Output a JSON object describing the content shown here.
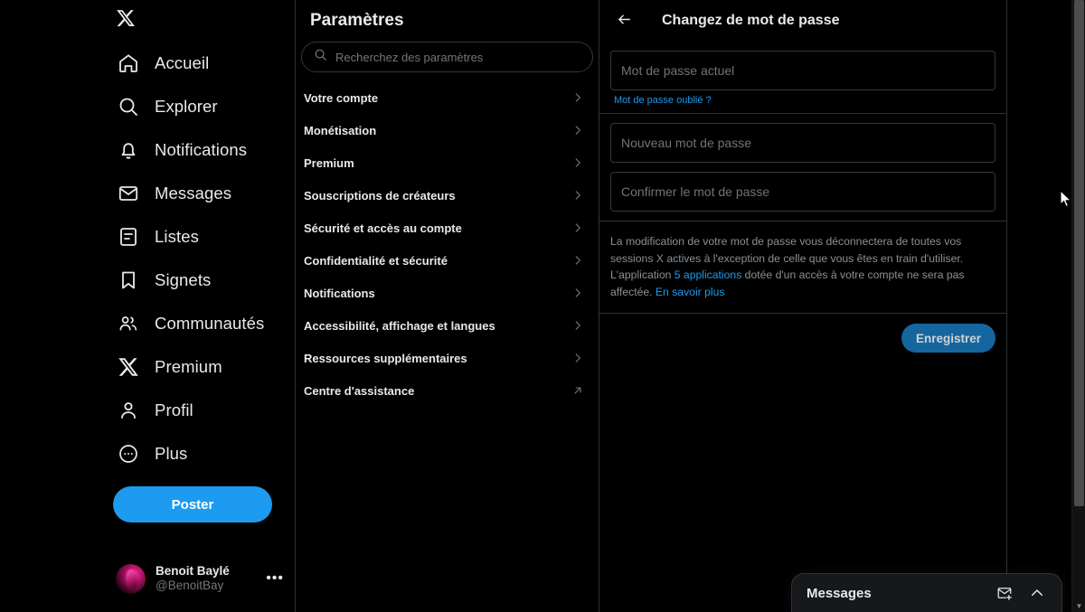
{
  "theme": {
    "accent": "#1d9bf0",
    "accent_dim": "#15669f",
    "text": "#e7e9ea",
    "muted": "#71767b",
    "border": "#2f3336"
  },
  "left_nav": {
    "logo_icon": "x-logo-icon",
    "items": [
      {
        "label": "Accueil",
        "icon": "home-icon"
      },
      {
        "label": "Explorer",
        "icon": "search-icon"
      },
      {
        "label": "Notifications",
        "icon": "bell-icon"
      },
      {
        "label": "Messages",
        "icon": "envelope-icon"
      },
      {
        "label": "Listes",
        "icon": "list-icon"
      },
      {
        "label": "Signets",
        "icon": "bookmark-icon"
      },
      {
        "label": "Communautés",
        "icon": "communities-icon"
      },
      {
        "label": "Premium",
        "icon": "x-logo-icon"
      },
      {
        "label": "Profil",
        "icon": "person-icon"
      },
      {
        "label": "Plus",
        "icon": "more-circle-icon"
      }
    ],
    "post_button": "Poster",
    "account": {
      "name": "Benoit Baylé",
      "handle": "@BenoitBay",
      "more_label": "•••"
    }
  },
  "settings": {
    "title": "Paramètres",
    "search_placeholder": "Recherchez des paramètres",
    "search_value": "",
    "items": [
      {
        "label": "Votre compte",
        "trailing": "chevron-right-icon"
      },
      {
        "label": "Monétisation",
        "trailing": "chevron-right-icon"
      },
      {
        "label": "Premium",
        "trailing": "chevron-right-icon"
      },
      {
        "label": "Souscriptions de créateurs",
        "trailing": "chevron-right-icon"
      },
      {
        "label": "Sécurité et accès au compte",
        "trailing": "chevron-right-icon"
      },
      {
        "label": "Confidentialité et sécurité",
        "trailing": "chevron-right-icon"
      },
      {
        "label": "Notifications",
        "trailing": "chevron-right-icon"
      },
      {
        "label": "Accessibilité, affichage et langues",
        "trailing": "chevron-right-icon"
      },
      {
        "label": "Ressources supplémentaires",
        "trailing": "chevron-right-icon"
      },
      {
        "label": "Centre d'assistance",
        "trailing": "external-link-icon"
      }
    ]
  },
  "detail": {
    "back_icon": "arrow-left-icon",
    "title": "Changez de mot de passe",
    "current_password": {
      "placeholder": "Mot de passe actuel",
      "value": ""
    },
    "forgot_link": "Mot de passe oublié ?",
    "new_password": {
      "placeholder": "Nouveau mot de passe",
      "value": ""
    },
    "confirm_password": {
      "placeholder": "Confirmer le mot de passe",
      "value": ""
    },
    "notice": {
      "text_part1": "La modification de votre mot de passe vous déconnectera de toutes vos sessions X actives à l'exception de celle que vous êtes en train d'utiliser. L'application ",
      "link_apps": "5 applications",
      "text_part2": " dotée d'un accès à votre compte ne sera pas affectée. ",
      "link_more": "En savoir plus"
    },
    "save_button": "Enregistrer"
  },
  "messages_dock": {
    "title": "Messages",
    "new_message_icon": "new-message-icon",
    "expand_icon": "chevron-up-icon"
  }
}
